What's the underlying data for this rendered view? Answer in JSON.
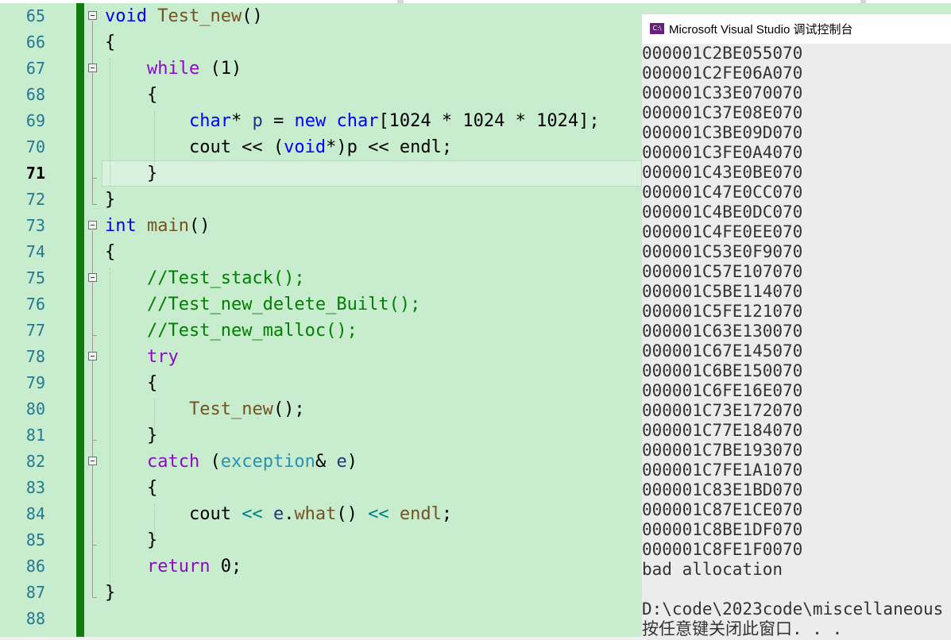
{
  "editor": {
    "lines": [
      {
        "number": "65",
        "tokens": [
          {
            "t": "void",
            "c": "kw"
          },
          {
            "t": " "
          },
          {
            "t": "Test_new",
            "c": "fn"
          },
          {
            "t": "()"
          }
        ]
      },
      {
        "number": "66",
        "tokens": [
          {
            "t": "{"
          }
        ]
      },
      {
        "number": "67",
        "tokens": [
          {
            "t": "    "
          },
          {
            "t": "while",
            "c": "ctl"
          },
          {
            "t": " (1)"
          }
        ]
      },
      {
        "number": "68",
        "tokens": [
          {
            "t": "    {"
          }
        ]
      },
      {
        "number": "69",
        "tokens": [
          {
            "t": "        "
          },
          {
            "t": "char",
            "c": "kw"
          },
          {
            "t": "* "
          },
          {
            "t": "p",
            "c": "var"
          },
          {
            "t": " = "
          },
          {
            "t": "new",
            "c": "kw"
          },
          {
            "t": " "
          },
          {
            "t": "char",
            "c": "kw"
          },
          {
            "t": "[1024 * 1024 * 1024];"
          }
        ]
      },
      {
        "number": "70",
        "tokens": [
          {
            "t": "        cout << ("
          },
          {
            "t": "void",
            "c": "kw"
          },
          {
            "t": "*)p << endl;"
          }
        ]
      },
      {
        "number": "71",
        "current": true,
        "tokens": [
          {
            "t": "    }"
          }
        ]
      },
      {
        "number": "72",
        "tokens": [
          {
            "t": "}"
          }
        ]
      },
      {
        "number": "73",
        "tokens": [
          {
            "t": "int",
            "c": "kw"
          },
          {
            "t": " "
          },
          {
            "t": "main",
            "c": "fn"
          },
          {
            "t": "()"
          }
        ]
      },
      {
        "number": "74",
        "tokens": [
          {
            "t": "{"
          }
        ]
      },
      {
        "number": "75",
        "tokens": [
          {
            "t": "    "
          },
          {
            "t": "//Test_stack();",
            "c": "cm"
          }
        ]
      },
      {
        "number": "76",
        "tokens": [
          {
            "t": "    "
          },
          {
            "t": "//Test_new_delete_Built();",
            "c": "cm"
          }
        ]
      },
      {
        "number": "77",
        "tokens": [
          {
            "t": "    "
          },
          {
            "t": "//Test_new_malloc();",
            "c": "cm"
          }
        ]
      },
      {
        "number": "78",
        "tokens": [
          {
            "t": "    "
          },
          {
            "t": "try",
            "c": "ctl"
          }
        ]
      },
      {
        "number": "79",
        "tokens": [
          {
            "t": "    {"
          }
        ]
      },
      {
        "number": "80",
        "tokens": [
          {
            "t": "        "
          },
          {
            "t": "Test_new",
            "c": "fn"
          },
          {
            "t": "();"
          }
        ]
      },
      {
        "number": "81",
        "tokens": [
          {
            "t": "    }"
          }
        ]
      },
      {
        "number": "82",
        "tokens": [
          {
            "t": "    "
          },
          {
            "t": "catch",
            "c": "ctl"
          },
          {
            "t": " ("
          },
          {
            "t": "exception",
            "c": "ty"
          },
          {
            "t": "& "
          },
          {
            "t": "e",
            "c": "var"
          },
          {
            "t": ")"
          }
        ]
      },
      {
        "number": "83",
        "tokens": [
          {
            "t": "    {"
          }
        ]
      },
      {
        "number": "84",
        "tokens": [
          {
            "t": "        cout "
          },
          {
            "t": "<<",
            "c": "op"
          },
          {
            "t": " "
          },
          {
            "t": "e",
            "c": "var"
          },
          {
            "t": "."
          },
          {
            "t": "what",
            "c": "fn"
          },
          {
            "t": "() "
          },
          {
            "t": "<<",
            "c": "op"
          },
          {
            "t": " "
          },
          {
            "t": "endl",
            "c": "fn"
          },
          {
            "t": ";"
          }
        ]
      },
      {
        "number": "85",
        "tokens": [
          {
            "t": "    }"
          }
        ]
      },
      {
        "number": "86",
        "tokens": [
          {
            "t": "    "
          },
          {
            "t": "return",
            "c": "ctl"
          },
          {
            "t": " 0;"
          }
        ]
      },
      {
        "number": "87",
        "tokens": [
          {
            "t": "}"
          }
        ]
      },
      {
        "number": "88",
        "tokens": []
      }
    ],
    "colors": {
      "background": "#c7ecce",
      "changebar": "#107c10",
      "keyword": "#0000ff",
      "control": "#8f08c4",
      "function": "#74531f",
      "comment": "#008000",
      "type": "#2b91af"
    }
  },
  "console": {
    "icon": "visual-studio-icon",
    "icon_text": "C:\\",
    "title": "Microsoft Visual Studio 调试控制台",
    "output": [
      "000001C2BE055070",
      "000001C2FE06A070",
      "000001C33E070070",
      "000001C37E08E070",
      "000001C3BE09D070",
      "000001C3FE0A4070",
      "000001C43E0BE070",
      "000001C47E0CC070",
      "000001C4BE0DC070",
      "000001C4FE0EE070",
      "000001C53E0F9070",
      "000001C57E107070",
      "000001C5BE114070",
      "000001C5FE121070",
      "000001C63E130070",
      "000001C67E145070",
      "000001C6BE150070",
      "000001C6FE16E070",
      "000001C73E172070",
      "000001C77E184070",
      "000001C7BE193070",
      "000001C7FE1A1070",
      "000001C83E1BD070",
      "000001C87E1CE070",
      "000001C8BE1DF070",
      "000001C8FE1F0070",
      "bad allocation",
      "",
      "D:\\code\\2023code\\miscellaneous",
      "按任意键关闭此窗口. . ."
    ]
  }
}
